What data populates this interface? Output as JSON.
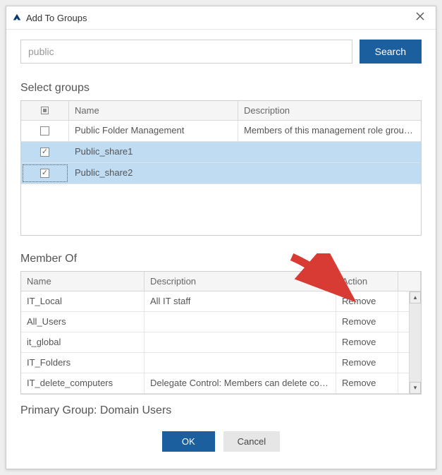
{
  "titlebar": {
    "title": "Add To Groups"
  },
  "search": {
    "value": "public",
    "button_label": "Search"
  },
  "select_groups": {
    "title": "Select groups",
    "headers": {
      "name": "Name",
      "description": "Description"
    },
    "rows": [
      {
        "checked": false,
        "selected": false,
        "name": "Public Folder Management",
        "description": "Members of this management role group can man..."
      },
      {
        "checked": true,
        "selected": true,
        "name": "Public_share1",
        "description": ""
      },
      {
        "checked": true,
        "selected": true,
        "focused": true,
        "name": "Public_share2",
        "description": ""
      }
    ]
  },
  "member_of": {
    "title": "Member Of",
    "headers": {
      "name": "Name",
      "description": "Description",
      "action": "Action"
    },
    "rows": [
      {
        "name": "IT_Local",
        "description": "All IT staff",
        "action": "Remove"
      },
      {
        "name": "All_Users",
        "description": "",
        "action": "Remove"
      },
      {
        "name": "it_global",
        "description": "",
        "action": "Remove"
      },
      {
        "name": "IT_Folders",
        "description": "",
        "action": "Remove"
      },
      {
        "name": "IT_delete_computers",
        "description": "Delegate Control: Members can delete computer obj...",
        "action": "Remove"
      }
    ]
  },
  "primary_group": {
    "label": "Primary Group: Domain Users"
  },
  "buttons": {
    "ok": "OK",
    "cancel": "Cancel"
  },
  "annotation": {
    "arrow_color": "#d83a34"
  }
}
